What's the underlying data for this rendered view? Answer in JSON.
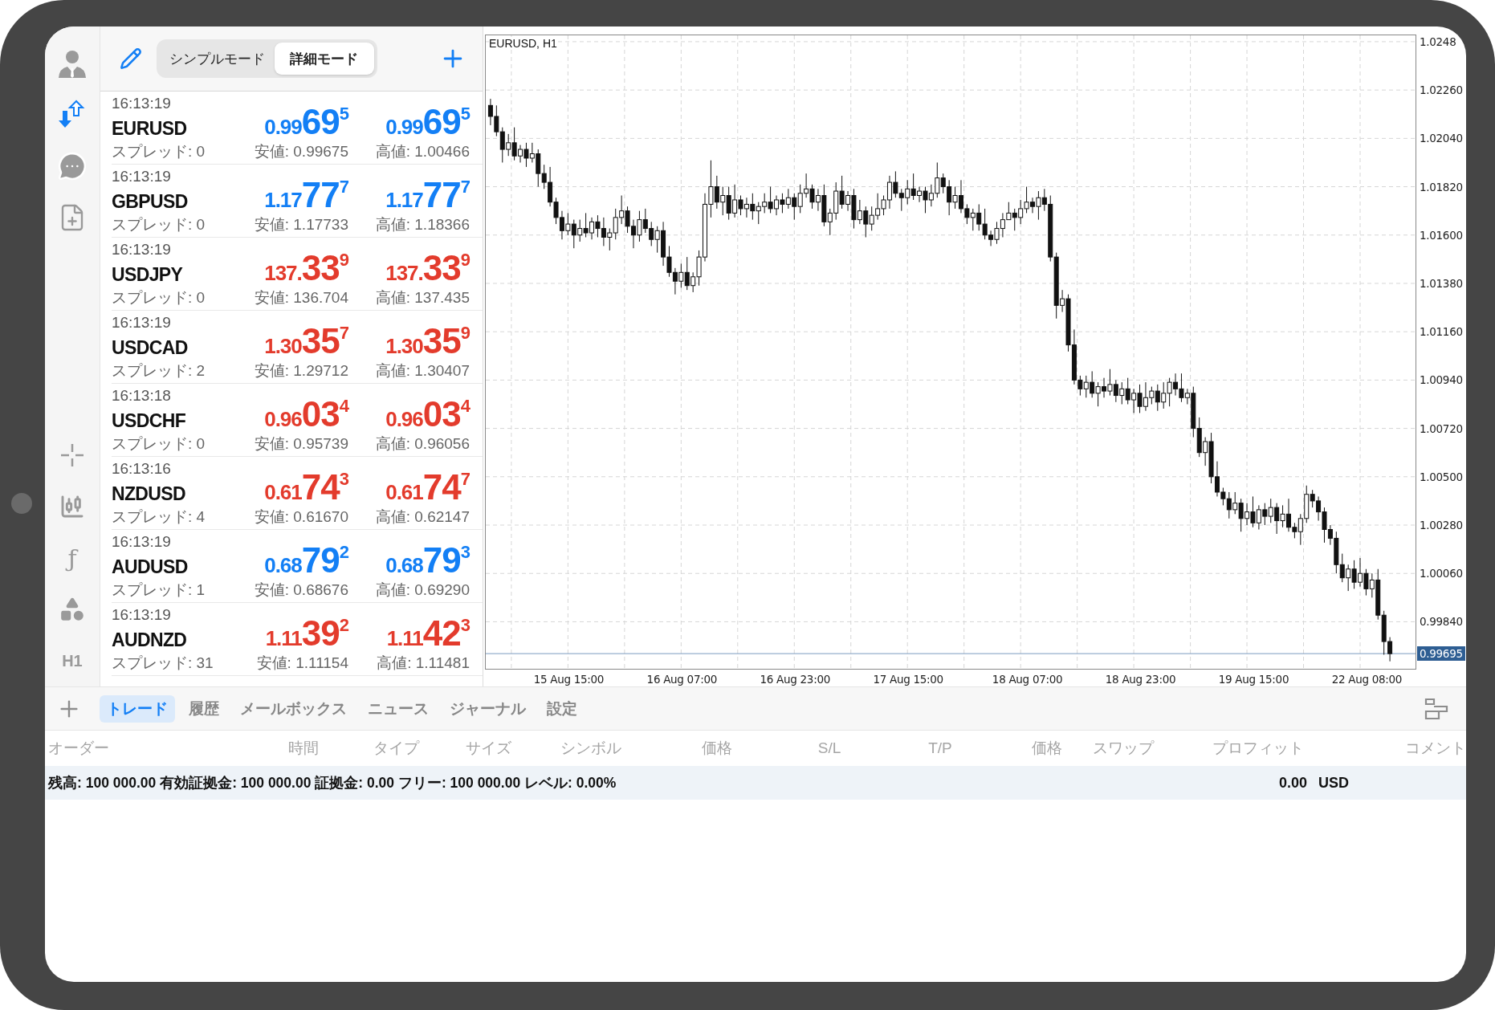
{
  "sidebar": {
    "function_glyph": "ƒ",
    "timeframe": "H1"
  },
  "quotes_header": {
    "modes": [
      {
        "label": "シンプルモード",
        "selected": false
      },
      {
        "label": "詳細モード",
        "selected": true
      }
    ]
  },
  "quotes": [
    {
      "time": "16:13:19",
      "symbol": "EURUSD",
      "spread": "スプレッド: 0",
      "bid": {
        "prefix": "0.99",
        "big": "69",
        "sup": "5"
      },
      "ask": {
        "prefix": "0.99",
        "big": "69",
        "sup": "5"
      },
      "low": "安値: 0.99675",
      "high": "高値: 1.00466",
      "color": "#137ff5"
    },
    {
      "time": "16:13:19",
      "symbol": "GBPUSD",
      "spread": "スプレッド: 0",
      "bid": {
        "prefix": "1.17",
        "big": "77",
        "sup": "7"
      },
      "ask": {
        "prefix": "1.17",
        "big": "77",
        "sup": "7"
      },
      "low": "安値: 1.17733",
      "high": "高値: 1.18366",
      "color": "#137ff5"
    },
    {
      "time": "16:13:19",
      "symbol": "USDJPY",
      "spread": "スプレッド: 0",
      "bid": {
        "prefix": "137.",
        "big": "33",
        "sup": "9"
      },
      "ask": {
        "prefix": "137.",
        "big": "33",
        "sup": "9"
      },
      "low": "安値: 136.704",
      "high": "高値: 137.435",
      "color": "#e33b2c"
    },
    {
      "time": "16:13:19",
      "symbol": "USDCAD",
      "spread": "スプレッド: 2",
      "bid": {
        "prefix": "1.30",
        "big": "35",
        "sup": "7"
      },
      "ask": {
        "prefix": "1.30",
        "big": "35",
        "sup": "9"
      },
      "low": "安値: 1.29712",
      "high": "高値: 1.30407",
      "color": "#e33b2c"
    },
    {
      "time": "16:13:18",
      "symbol": "USDCHF",
      "spread": "スプレッド: 0",
      "bid": {
        "prefix": "0.96",
        "big": "03",
        "sup": "4"
      },
      "ask": {
        "prefix": "0.96",
        "big": "03",
        "sup": "4"
      },
      "low": "安値: 0.95739",
      "high": "高値: 0.96056",
      "color": "#e33b2c"
    },
    {
      "time": "16:13:16",
      "symbol": "NZDUSD",
      "spread": "スプレッド: 4",
      "bid": {
        "prefix": "0.61",
        "big": "74",
        "sup": "3"
      },
      "ask": {
        "prefix": "0.61",
        "big": "74",
        "sup": "7"
      },
      "low": "安値: 0.61670",
      "high": "高値: 0.62147",
      "color": "#e33b2c"
    },
    {
      "time": "16:13:19",
      "symbol": "AUDUSD",
      "spread": "スプレッド: 1",
      "bid": {
        "prefix": "0.68",
        "big": "79",
        "sup": "2"
      },
      "ask": {
        "prefix": "0.68",
        "big": "79",
        "sup": "3"
      },
      "low": "安値: 0.68676",
      "high": "高値: 0.69290",
      "color": "#137ff5"
    },
    {
      "time": "16:13:19",
      "symbol": "AUDNZD",
      "spread": "スプレッド: 31",
      "bid": {
        "prefix": "1.11",
        "big": "39",
        "sup": "2"
      },
      "ask": {
        "prefix": "1.11",
        "big": "42",
        "sup": "3"
      },
      "low": "安値: 1.11154",
      "high": "高値: 1.11481",
      "color": "#e33b2c"
    }
  ],
  "chart": {
    "title": "EURUSD, H1",
    "chart_data": {
      "type": "candlestick",
      "grid": true,
      "ylim": [
        0.99626,
        1.02509
      ],
      "ref_lines": [
        {
          "axis": "y",
          "value": 0.99695,
          "label": "0.99695"
        }
      ],
      "yticks": [
        {
          "value": 1.0248,
          "label": "1.0248"
        },
        {
          "value": 1.0226,
          "label": "1.02260"
        },
        {
          "value": 1.0204,
          "label": "1.02040"
        },
        {
          "value": 1.0182,
          "label": "1.01820"
        },
        {
          "value": 1.016,
          "label": "1.01600"
        },
        {
          "value": 1.0138,
          "label": "1.01380"
        },
        {
          "value": 1.0116,
          "label": "1.01160"
        },
        {
          "value": 1.0094,
          "label": "1.00940"
        },
        {
          "value": 1.0072,
          "label": "1.00720"
        },
        {
          "value": 1.005,
          "label": "1.00500"
        },
        {
          "value": 1.0028,
          "label": "1.00280"
        },
        {
          "value": 1.0006,
          "label": "1.00060"
        },
        {
          "value": 0.9984,
          "label": "0.99840"
        }
      ],
      "categories": [
        null,
        null,
        null,
        null,
        null,
        null,
        null,
        null,
        null,
        null,
        null,
        null,
        null,
        "15 Aug 15:00",
        null,
        null,
        null,
        null,
        null,
        null,
        null,
        null,
        null,
        null,
        null,
        null,
        null,
        null,
        null,
        null,
        null,
        null,
        "16 Aug 07:00",
        null,
        null,
        null,
        null,
        null,
        null,
        null,
        null,
        null,
        null,
        null,
        null,
        null,
        null,
        null,
        null,
        null,
        null,
        "16 Aug 23:00",
        null,
        null,
        null,
        null,
        null,
        null,
        null,
        null,
        null,
        null,
        null,
        null,
        null,
        null,
        null,
        null,
        null,
        null,
        "17 Aug 15:00",
        null,
        null,
        null,
        null,
        null,
        null,
        null,
        null,
        null,
        null,
        null,
        null,
        null,
        null,
        null,
        null,
        null,
        null,
        null,
        "18 Aug 07:00",
        null,
        null,
        null,
        null,
        null,
        null,
        null,
        null,
        null,
        null,
        null,
        null,
        null,
        null,
        null,
        null,
        null,
        null,
        "18 Aug 23:00",
        null,
        null,
        null,
        null,
        null,
        null,
        null,
        null,
        null,
        null,
        null,
        null,
        null,
        null,
        null,
        null,
        null,
        null,
        "19 Aug 15:00",
        null,
        null,
        null,
        null,
        null,
        null,
        null,
        null,
        null,
        null,
        null,
        null,
        null,
        null,
        null,
        null,
        null,
        null,
        "22 Aug 08:00",
        null,
        null,
        null,
        null
      ],
      "ohlc": [
        [
          1.0219,
          1.0222,
          1.021,
          1.0214
        ],
        [
          1.0214,
          1.0219,
          1.0205,
          1.0207
        ],
        [
          1.0207,
          1.0209,
          1.0193,
          1.0199
        ],
        [
          1.0199,
          1.0206,
          1.0196,
          1.0202
        ],
        [
          1.0202,
          1.0209,
          1.0194,
          1.0196
        ],
        [
          1.0196,
          1.0201,
          1.0193,
          1.0199
        ],
        [
          1.0199,
          1.0202,
          1.0191,
          1.0195
        ],
        [
          1.0195,
          1.0202,
          1.0193,
          1.0197
        ],
        [
          1.0197,
          1.0199,
          1.0182,
          1.0188
        ],
        [
          1.0188,
          1.0192,
          1.0181,
          1.0184
        ],
        [
          1.0184,
          1.0191,
          1.0173,
          1.0175
        ],
        [
          1.0175,
          1.0177,
          1.0165,
          1.0168
        ],
        [
          1.0168,
          1.0171,
          1.0158,
          1.0162
        ],
        [
          1.0162,
          1.017,
          1.016,
          1.0165
        ],
        [
          1.0165,
          1.0167,
          1.0154,
          1.016
        ],
        [
          1.016,
          1.0167,
          1.0157,
          1.0163
        ],
        [
          1.0163,
          1.017,
          1.0159,
          1.0161
        ],
        [
          1.0161,
          1.0168,
          1.0158,
          1.0166
        ],
        [
          1.0166,
          1.0169,
          1.0159,
          1.0163
        ],
        [
          1.0163,
          1.0168,
          1.0155,
          1.0159
        ],
        [
          1.0159,
          1.0163,
          1.0153,
          1.0161
        ],
        [
          1.0161,
          1.0172,
          1.0158,
          1.0168
        ],
        [
          1.0168,
          1.0178,
          1.0165,
          1.0171
        ],
        [
          1.0171,
          1.0173,
          1.0161,
          1.0164
        ],
        [
          1.0164,
          1.0167,
          1.0154,
          1.016
        ],
        [
          1.016,
          1.0171,
          1.0157,
          1.0167
        ],
        [
          1.0167,
          1.0172,
          1.0161,
          1.0163
        ],
        [
          1.0163,
          1.0166,
          1.0155,
          1.0158
        ],
        [
          1.0158,
          1.0164,
          1.0152,
          1.0162
        ],
        [
          1.0162,
          1.0166,
          1.0146,
          1.015
        ],
        [
          1.015,
          1.0155,
          1.0141,
          1.0143
        ],
        [
          1.0143,
          1.0145,
          1.0133,
          1.0139
        ],
        [
          1.0139,
          1.0147,
          1.0136,
          1.0143
        ],
        [
          1.0143,
          1.015,
          1.0135,
          1.0137
        ],
        [
          1.0137,
          1.0143,
          1.0134,
          1.0141
        ],
        [
          1.0141,
          1.0153,
          1.0137,
          1.015
        ],
        [
          1.015,
          1.0179,
          1.0148,
          1.0174
        ],
        [
          1.0174,
          1.0194,
          1.0168,
          1.0182
        ],
        [
          1.0182,
          1.0187,
          1.0172,
          1.0175
        ],
        [
          1.0175,
          1.0182,
          1.0169,
          1.0178
        ],
        [
          1.0178,
          1.0182,
          1.0167,
          1.017
        ],
        [
          1.017,
          1.0183,
          1.0168,
          1.0176
        ],
        [
          1.0176,
          1.0178,
          1.0169,
          1.0172
        ],
        [
          1.0172,
          1.0177,
          1.0168,
          1.0174
        ],
        [
          1.0174,
          1.0179,
          1.0167,
          1.0171
        ],
        [
          1.0171,
          1.0175,
          1.0165,
          1.0173
        ],
        [
          1.0173,
          1.0179,
          1.017,
          1.0175
        ],
        [
          1.0175,
          1.0182,
          1.017,
          1.0172
        ],
        [
          1.0172,
          1.0178,
          1.0169,
          1.0176
        ],
        [
          1.0176,
          1.0179,
          1.017,
          1.0174
        ],
        [
          1.0174,
          1.0181,
          1.0172,
          1.0177
        ],
        [
          1.0177,
          1.0179,
          1.0167,
          1.0173
        ],
        [
          1.0173,
          1.0183,
          1.017,
          1.0179
        ],
        [
          1.0179,
          1.0188,
          1.0177,
          1.0181
        ],
        [
          1.0181,
          1.0183,
          1.0172,
          1.0175
        ],
        [
          1.0175,
          1.0181,
          1.0171,
          1.0178
        ],
        [
          1.0178,
          1.0183,
          1.0164,
          1.0166
        ],
        [
          1.0166,
          1.0172,
          1.016,
          1.017
        ],
        [
          1.017,
          1.0184,
          1.0167,
          1.018
        ],
        [
          1.018,
          1.0187,
          1.0172,
          1.0174
        ],
        [
          1.0174,
          1.018,
          1.0171,
          1.0178
        ],
        [
          1.0178,
          1.0181,
          1.0163,
          1.0167
        ],
        [
          1.0167,
          1.0176,
          1.0165,
          1.0171
        ],
        [
          1.0171,
          1.0173,
          1.0159,
          1.0165
        ],
        [
          1.0165,
          1.0173,
          1.0162,
          1.0169
        ],
        [
          1.0169,
          1.0179,
          1.0167,
          1.0172
        ],
        [
          1.0172,
          1.0178,
          1.0169,
          1.0176
        ],
        [
          1.0176,
          1.0187,
          1.0172,
          1.0184
        ],
        [
          1.0184,
          1.0189,
          1.0177,
          1.0179
        ],
        [
          1.0179,
          1.0181,
          1.0171,
          1.0177
        ],
        [
          1.0177,
          1.0185,
          1.0174,
          1.0181
        ],
        [
          1.0181,
          1.0188,
          1.0176,
          1.0178
        ],
        [
          1.0178,
          1.0182,
          1.0175,
          1.018
        ],
        [
          1.018,
          1.0182,
          1.017,
          1.0176
        ],
        [
          1.0176,
          1.0183,
          1.0173,
          1.0179
        ],
        [
          1.0179,
          1.0193,
          1.0177,
          1.0186
        ],
        [
          1.0186,
          1.0188,
          1.0179,
          1.0182
        ],
        [
          1.0182,
          1.0185,
          1.0169,
          1.0175
        ],
        [
          1.0175,
          1.0182,
          1.0172,
          1.0178
        ],
        [
          1.0178,
          1.0185,
          1.017,
          1.0172
        ],
        [
          1.0172,
          1.0174,
          1.0165,
          1.0168
        ],
        [
          1.0168,
          1.0172,
          1.0162,
          1.017
        ],
        [
          1.017,
          1.0174,
          1.0162,
          1.0165
        ],
        [
          1.0165,
          1.0172,
          1.0158,
          1.016
        ],
        [
          1.016,
          1.0162,
          1.0155,
          1.0158
        ],
        [
          1.0158,
          1.0166,
          1.0156,
          1.0163
        ],
        [
          1.0163,
          1.017,
          1.0159,
          1.0167
        ],
        [
          1.0167,
          1.0175,
          1.0167,
          1.017
        ],
        [
          1.017,
          1.0172,
          1.0162,
          1.0168
        ],
        [
          1.0168,
          1.0176,
          1.0165,
          1.0172
        ],
        [
          1.0172,
          1.0182,
          1.017,
          1.0175
        ],
        [
          1.0175,
          1.0177,
          1.017,
          1.0173
        ],
        [
          1.0173,
          1.018,
          1.0167,
          1.0177
        ],
        [
          1.0177,
          1.0181,
          1.0171,
          1.0174
        ],
        [
          1.0174,
          1.0178,
          1.0148,
          1.015
        ],
        [
          1.015,
          1.0152,
          1.0122,
          1.0128
        ],
        [
          1.0128,
          1.0135,
          1.0125,
          1.0131
        ],
        [
          1.0131,
          1.0133,
          1.0107,
          1.011
        ],
        [
          1.011,
          1.0117,
          1.0092,
          1.0094
        ],
        [
          1.0094,
          1.0096,
          1.0087,
          1.009
        ],
        [
          1.009,
          1.0096,
          1.0086,
          1.0093
        ],
        [
          1.0093,
          1.0098,
          1.0086,
          1.0088
        ],
        [
          1.0088,
          1.0093,
          1.0082,
          1.0091
        ],
        [
          1.0091,
          1.0095,
          1.0086,
          1.0089
        ],
        [
          1.0089,
          1.0099,
          1.0087,
          1.0092
        ],
        [
          1.0092,
          1.0094,
          1.0084,
          1.0087
        ],
        [
          1.0087,
          1.0093,
          1.0083,
          1.009
        ],
        [
          1.009,
          1.0095,
          1.0083,
          1.0085
        ],
        [
          1.0085,
          1.009,
          1.0079,
          1.0088
        ],
        [
          1.0088,
          1.0092,
          1.0079,
          1.0082
        ],
        [
          1.0082,
          1.0093,
          1.008,
          1.0086
        ],
        [
          1.0086,
          1.0091,
          1.0083,
          1.0089
        ],
        [
          1.0089,
          1.0092,
          1.008,
          1.0084
        ],
        [
          1.0084,
          1.0093,
          1.0081,
          1.0088
        ],
        [
          1.0088,
          1.0095,
          1.0082,
          1.0093
        ],
        [
          1.0093,
          1.0097,
          1.0087,
          1.009
        ],
        [
          1.009,
          1.0097,
          1.0084,
          1.0086
        ],
        [
          1.0086,
          1.009,
          1.0083,
          1.0088
        ],
        [
          1.0088,
          1.0091,
          1.0068,
          1.0072
        ],
        [
          1.0072,
          1.0077,
          1.0059,
          1.0061
        ],
        [
          1.0061,
          1.0068,
          1.0055,
          1.0066
        ],
        [
          1.0066,
          1.007,
          1.0047,
          1.005
        ],
        [
          1.005,
          1.0057,
          1.0041,
          1.0043
        ],
        [
          1.0043,
          1.0045,
          1.0037,
          1.004
        ],
        [
          1.004,
          1.0043,
          1.0031,
          1.0035
        ],
        [
          1.0035,
          1.0043,
          1.0033,
          1.0038
        ],
        [
          1.0038,
          1.004,
          1.0025,
          1.0031
        ],
        [
          1.0031,
          1.0038,
          1.0028,
          1.0034
        ],
        [
          1.0034,
          1.0041,
          1.0027,
          1.0029
        ],
        [
          1.0029,
          1.0037,
          1.0026,
          1.0035
        ],
        [
          1.0035,
          1.0038,
          1.0028,
          1.0032
        ],
        [
          1.0032,
          1.004,
          1.0029,
          1.0036
        ],
        [
          1.0036,
          1.0038,
          1.0024,
          1.003
        ],
        [
          1.003,
          1.0037,
          1.0027,
          1.0033
        ],
        [
          1.0033,
          1.004,
          1.0025,
          1.0027
        ],
        [
          1.0027,
          1.0029,
          1.0022,
          1.0025
        ],
        [
          1.0025,
          1.0033,
          1.0019,
          1.0031
        ],
        [
          1.0031,
          1.0046,
          1.0029,
          1.0042
        ],
        [
          1.0042,
          1.0044,
          1.0036,
          1.0039
        ],
        [
          1.0039,
          1.0041,
          1.003,
          1.0034
        ],
        [
          1.0034,
          1.0036,
          1.002,
          1.0026
        ],
        [
          1.0026,
          1.0028,
          1.0019,
          1.0022
        ],
        [
          1.0022,
          1.0025,
          1.0006,
          1.001
        ],
        [
          1.001,
          1.0015,
          1.0002,
          1.0004
        ],
        [
          1.0004,
          1.001,
          0.9998,
          1.0008
        ],
        [
          1.0008,
          1.0012,
          0.9999,
          1.0002
        ],
        [
          1.0002,
          1.0013,
          1.0,
          1.0006
        ],
        [
          1.0006,
          1.0008,
          0.9996,
          0.9999
        ],
        [
          0.9999,
          1.0006,
          0.9995,
          1.0003
        ],
        [
          1.0003,
          1.0008,
          0.9985,
          0.9987
        ],
        [
          0.9987,
          0.9989,
          0.9969,
          0.9975
        ],
        [
          0.9975,
          0.9977,
          0.9966,
          0.99695
        ]
      ]
    }
  },
  "toolbox": {
    "tabs": [
      {
        "label": "トレード",
        "selected": true
      },
      {
        "label": "履歴",
        "selected": false
      },
      {
        "label": "メールボックス",
        "selected": false
      },
      {
        "label": "ニュース",
        "selected": false
      },
      {
        "label": "ジャーナル",
        "selected": false
      },
      {
        "label": "設定",
        "selected": false
      }
    ]
  },
  "table": {
    "columns": [
      "オーダー",
      "時間",
      "タイプ",
      "サイズ",
      "シンボル",
      "価格",
      "S/L",
      "T/P",
      "価格",
      "スワップ",
      "プロフィット",
      "コメント"
    ]
  },
  "summary": {
    "text": "残高: 100 000.00 有効証拠金: 100 000.00 証拠金: 0.00 フリー: 100 000.00 レベル: 0.00%",
    "profit": "0.00",
    "currency": "USD"
  }
}
